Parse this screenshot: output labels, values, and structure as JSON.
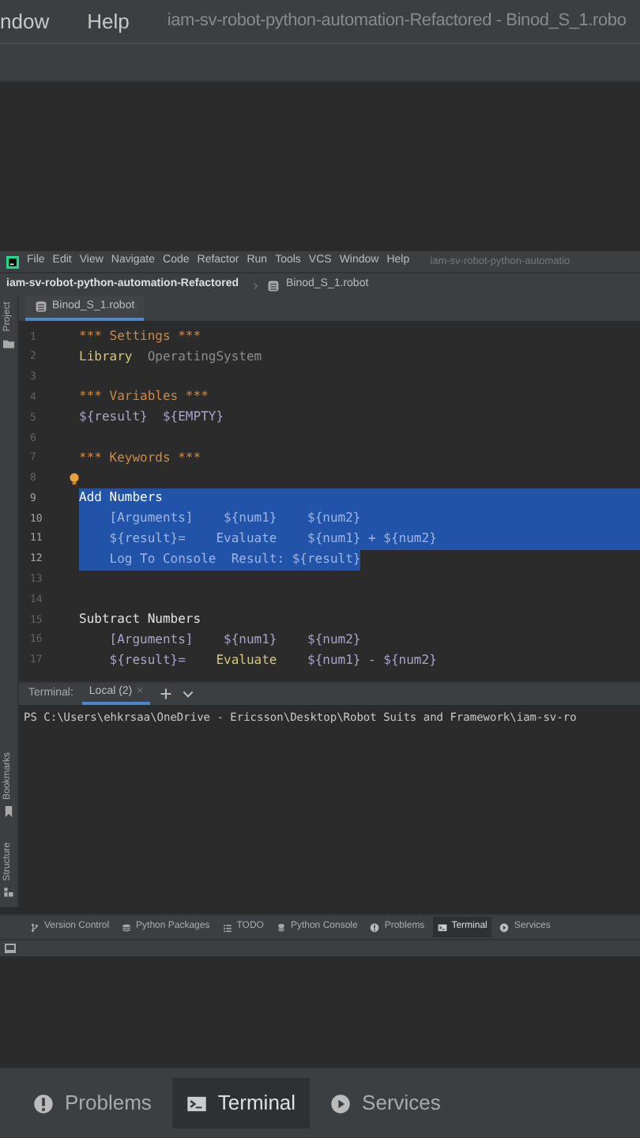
{
  "zoomed_top": {
    "menu": [
      {
        "label": "ndow"
      },
      {
        "label": "Help"
      }
    ],
    "title": "iam-sv-robot-python-automation-Refactored - Binod_S_1.robo"
  },
  "ide": {
    "menu": [
      {
        "label": "File"
      },
      {
        "label": "Edit"
      },
      {
        "label": "View"
      },
      {
        "label": "Navigate"
      },
      {
        "label": "Code"
      },
      {
        "label": "Refactor"
      },
      {
        "label": "Run"
      },
      {
        "label": "Tools"
      },
      {
        "label": "VCS"
      },
      {
        "label": "Window"
      },
      {
        "label": "Help"
      }
    ],
    "title": "iam-sv-robot-python-automatio",
    "breadcrumb": {
      "project": "iam-sv-robot-python-automation-Refactored",
      "file": "Binod_S_1.robot"
    },
    "side_tools_top": [
      {
        "label": "Project"
      }
    ],
    "side_tools_bottom": [
      {
        "label": "Bookmarks"
      },
      {
        "label": "Structure"
      }
    ],
    "editor_tabs": [
      {
        "label": "Binod_S_1.robot",
        "selected": true
      }
    ],
    "lines": [
      {
        "number": "1",
        "bulb": false,
        "selected": false,
        "tokens": [
          {
            "text": "*** Settings ***",
            "kind": "header"
          }
        ]
      },
      {
        "number": "2",
        "bulb": false,
        "selected": false,
        "tokens": [
          {
            "text": "Library",
            "kind": "setting"
          },
          {
            "text": "  OperatingSystem",
            "kind": "plain"
          }
        ]
      },
      {
        "number": "3",
        "bulb": false,
        "selected": false
      },
      {
        "number": "4",
        "bulb": false,
        "selected": false,
        "tokens": [
          {
            "text": "*** Variables ***",
            "kind": "header"
          }
        ]
      },
      {
        "number": "5",
        "bulb": false,
        "selected": false,
        "tokens": [
          {
            "text": "${result}  ${EMPTY}",
            "kind": "variable"
          }
        ]
      },
      {
        "number": "6",
        "bulb": false,
        "selected": false
      },
      {
        "number": "7",
        "bulb": false,
        "selected": false,
        "tokens": [
          {
            "text": "*** Keywords ***",
            "kind": "header"
          }
        ]
      },
      {
        "number": "8",
        "bulb": true,
        "selected": false
      },
      {
        "number": "9",
        "bulb": false,
        "selected": true,
        "tokens": [
          {
            "text": "Add Numbers",
            "kind": "name"
          }
        ]
      },
      {
        "number": "10",
        "bulb": false,
        "selected": true,
        "tokens": [
          {
            "text": "    [Arguments]",
            "kind": "argument"
          },
          {
            "text": "    ${num1}    ${num2}",
            "kind": "variable"
          }
        ]
      },
      {
        "number": "11",
        "bulb": false,
        "selected": true,
        "tokens": [
          {
            "text": "    ${result}=",
            "kind": "variable"
          },
          {
            "text": "    Evaluate",
            "kind": "keyword"
          },
          {
            "text": "    ${num1} + ${num2}",
            "kind": "variable"
          }
        ]
      },
      {
        "number": "12",
        "bulb": false,
        "selected": true,
        "tokens": [
          {
            "text": "    Log To Console  Result: ",
            "kind": "keyword"
          },
          {
            "text": "${result}",
            "kind": "variable"
          }
        ]
      },
      {
        "number": "13",
        "bulb": false,
        "selected": false
      },
      {
        "number": "14",
        "bulb": false,
        "selected": false
      },
      {
        "number": "15",
        "bulb": false,
        "selected": false,
        "tokens": [
          {
            "text": "Subtract Numbers",
            "kind": "name"
          }
        ]
      },
      {
        "number": "16",
        "bulb": false,
        "selected": false,
        "tokens": [
          {
            "text": "    [Arguments]",
            "kind": "argument"
          },
          {
            "text": "    ${num1}    ${num2}",
            "kind": "variable"
          }
        ]
      },
      {
        "number": "17",
        "bulb": false,
        "selected": false,
        "tokens": [
          {
            "text": "    ${result}=",
            "kind": "variable"
          },
          {
            "text": "    Evaluate",
            "kind": "keyword"
          },
          {
            "text": "    ${num1} - ${num2}",
            "kind": "variable"
          }
        ]
      }
    ],
    "terminal": {
      "label": "Terminal:",
      "tabs": [
        {
          "label": "Local (2)",
          "selected": true,
          "close": "×"
        }
      ],
      "output": "PS C:\\Users\\ehkrsaa\\OneDrive - Ericsson\\Desktop\\Robot Suits and Framework\\iam-sv-ro"
    },
    "tool_windows": [
      {
        "label": "Version Control",
        "kind": "vcs",
        "selected": false
      },
      {
        "label": "Python Packages",
        "kind": "packages",
        "selected": false
      },
      {
        "label": "TODO",
        "kind": "todo",
        "selected": false
      },
      {
        "label": "Python Console",
        "kind": "console",
        "selected": false
      },
      {
        "label": "Problems",
        "kind": "problems",
        "selected": false
      },
      {
        "label": "Terminal",
        "kind": "terminal",
        "selected": true
      },
      {
        "label": "Services",
        "kind": "services",
        "selected": false
      }
    ]
  },
  "zoomed_bottom": {
    "tool_windows": [
      {
        "label": "Problems",
        "kind": "problems",
        "selected": false
      },
      {
        "label": "Terminal",
        "kind": "terminal",
        "selected": true
      },
      {
        "label": "Services",
        "kind": "services",
        "selected": false
      }
    ]
  }
}
